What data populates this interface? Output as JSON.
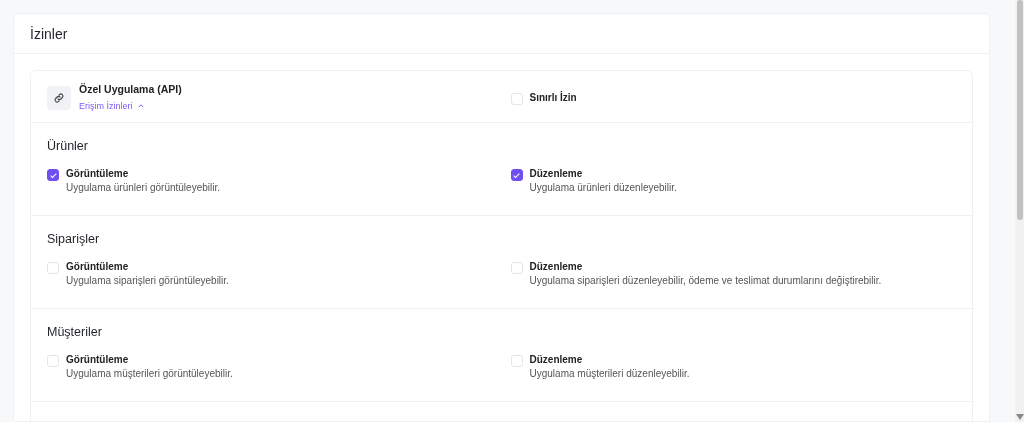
{
  "card": {
    "title": "İzinler"
  },
  "app": {
    "name": "Özel Uygulama (API)",
    "link": "Erişim İzinleri",
    "expanded": true,
    "limited": {
      "label": "Sınırlı İzin",
      "checked": false
    }
  },
  "sections": [
    {
      "title": "Ürünler",
      "permissions": [
        {
          "label": "Görüntüleme",
          "description": "Uygulama ürünleri görüntüleyebilir.",
          "checked": true
        },
        {
          "label": "Düzenleme",
          "description": "Uygulama ürünleri düzenleyebilir.",
          "checked": true
        }
      ]
    },
    {
      "title": "Siparişler",
      "permissions": [
        {
          "label": "Görüntüleme",
          "description": "Uygulama siparişleri görüntüleyebilir.",
          "checked": false
        },
        {
          "label": "Düzenleme",
          "description": "Uygulama siparişleri düzenleyebilir, ödeme ve teslimat durumlarını değiştirebilir.",
          "checked": false
        }
      ]
    },
    {
      "title": "Müşteriler",
      "permissions": [
        {
          "label": "Görüntüleme",
          "description": "Uygulama müşterileri görüntüleyebilir.",
          "checked": false
        },
        {
          "label": "Düzenleme",
          "description": "Uygulama müşterileri düzenleyebilir.",
          "checked": false
        }
      ]
    }
  ]
}
